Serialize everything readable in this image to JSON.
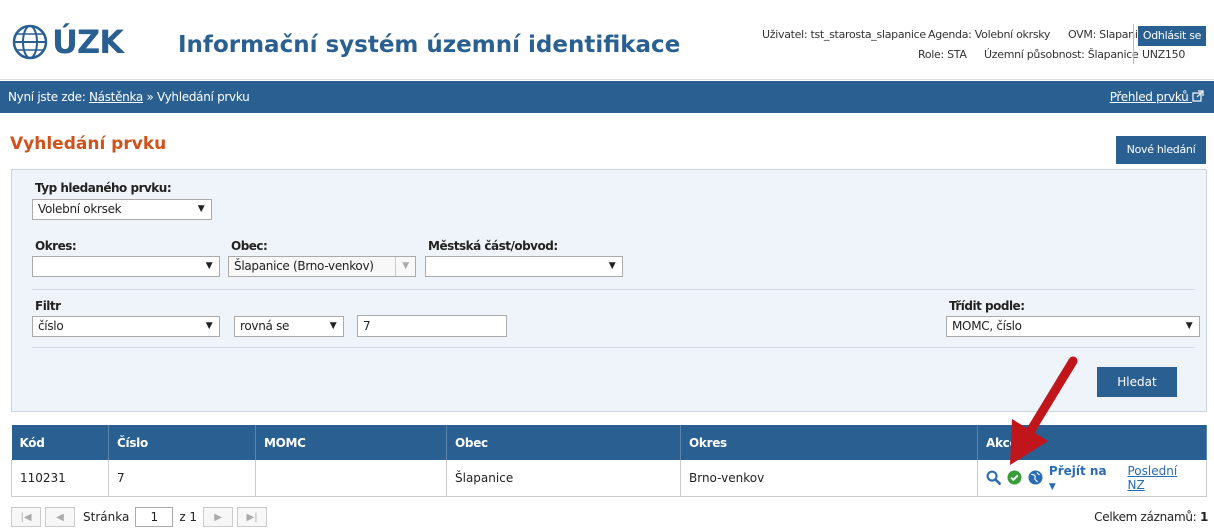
{
  "header": {
    "logo_text": "ÚZK",
    "app_title": "Informační systém územní identifikace",
    "user_label": "Uživatel: tst_starosta_slapanice",
    "agenda_label": "Agenda: Volební okrsky",
    "ovm_label": "OVM: Slapanice",
    "role_label": "Role: STA",
    "scope_label": "Územní působnost: Šlapanice",
    "code_label": "UNZ150",
    "logout_label": "Odhlásit se"
  },
  "nav": {
    "prefix": "Nyní jste zde:",
    "dashboard_link": "Nástěnka",
    "separator": "»",
    "current": "Vyhledání prvku",
    "overview_link": "Přehled prvků"
  },
  "page": {
    "title": "Vyhledání prvku",
    "new_search_label": "Nové hledání"
  },
  "form": {
    "type_label": "Typ hledaného prvku:",
    "type_value": "Volební okrsek",
    "okres_label": "Okres:",
    "okres_value": "",
    "obec_label": "Obec:",
    "obec_value": "Šlapanice (Brno-venkov)",
    "mestska_cast_label": "Městská část/obvod:",
    "mestska_cast_value": "",
    "filter_label": "Filtr",
    "filter_field_value": "číslo",
    "filter_op_value": "rovná se",
    "filter_value": "7",
    "sort_label": "Třídit podle:",
    "sort_value": "MOMC, číslo",
    "search_label": "Hledat"
  },
  "table": {
    "columns": [
      "Kód",
      "Číslo",
      "MOMC",
      "Obec",
      "Okres",
      "Akce"
    ],
    "rows": [
      {
        "kod": "110231",
        "cislo": "7",
        "momc": "",
        "obec": "Šlapanice",
        "okres": "Brno-venkov"
      }
    ],
    "goto_label": "Přejít na",
    "last_nz_label": "Poslední NZ"
  },
  "pager": {
    "page_label": "Stránka",
    "page_value": "1",
    "of_label": "z 1",
    "total_label": "Celkem záznamů:",
    "total_value": "1"
  },
  "colors": {
    "brand": "#2a5f91",
    "title": "#d0521b",
    "arrow": "#c0161b"
  }
}
